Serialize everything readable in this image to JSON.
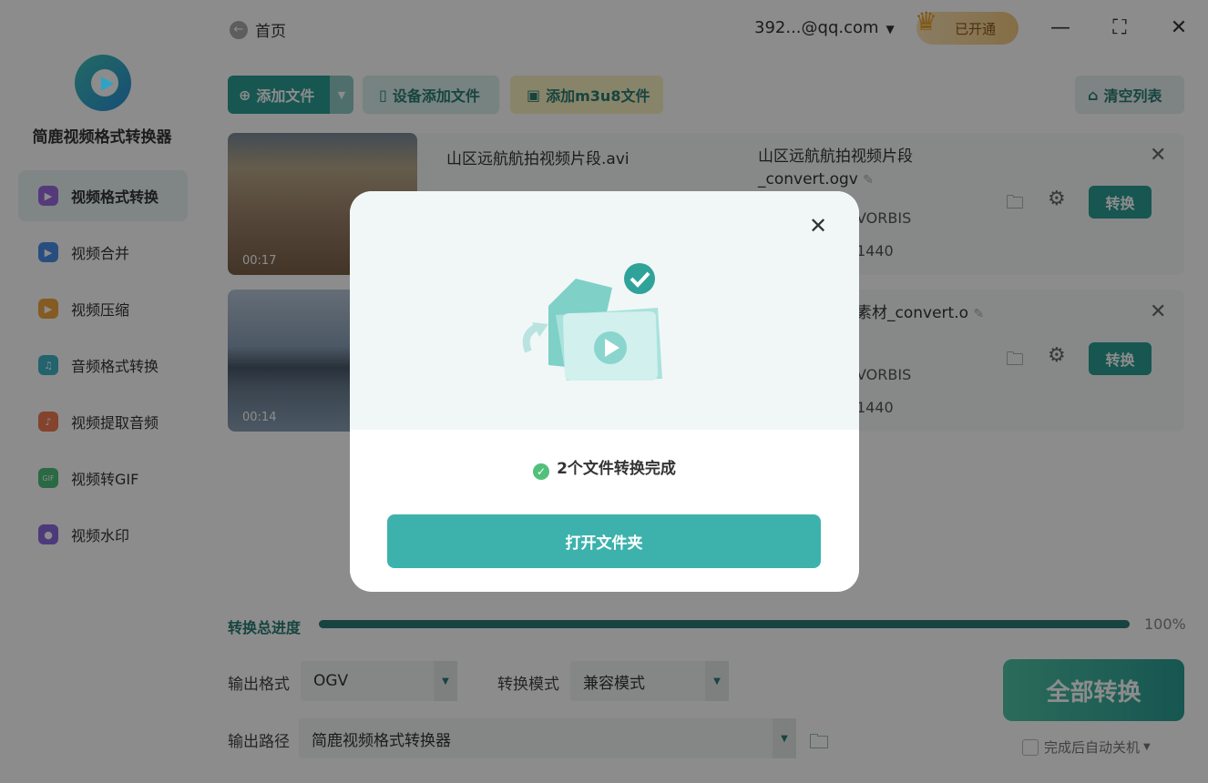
{
  "app": {
    "name": "简鹿视频格式转换器"
  },
  "sidebar": {
    "items": [
      {
        "label": "视频格式转换",
        "color": "#9b6be0",
        "icon": "video-convert-icon"
      },
      {
        "label": "视频合并",
        "color": "#4a8fe8",
        "icon": "video-merge-icon"
      },
      {
        "label": "视频压缩",
        "color": "#f0a640",
        "icon": "video-compress-icon"
      },
      {
        "label": "音频格式转换",
        "color": "#3fb4c6",
        "icon": "audio-convert-icon"
      },
      {
        "label": "视频提取音频",
        "color": "#f07a50",
        "icon": "extract-audio-icon"
      },
      {
        "label": "视频转GIF",
        "color": "#4cc07a",
        "icon": "gif-icon"
      },
      {
        "label": "视频水印",
        "color": "#8a6be0",
        "icon": "watermark-icon"
      }
    ]
  },
  "header": {
    "back_label": "首页",
    "user": "392...@qq.com",
    "vip_label": "已开通"
  },
  "toolbar": {
    "add_file": "添加文件",
    "device_add": "设备添加文件",
    "add_m3u8": "添加m3u8文件",
    "clear_list": "清空列表"
  },
  "files": [
    {
      "duration": "00:17",
      "name": "山区远航航拍视频片段.avi",
      "output_name": "山区远航航拍视频片段_convert.ogv",
      "codec": "VORBIS",
      "resolution": "1440",
      "convert_label": "转换"
    },
    {
      "duration": "00:14",
      "output_name": "素材_convert.o",
      "codec": "VORBIS",
      "resolution": "1440",
      "convert_label": "转换"
    }
  ],
  "bottom": {
    "progress_label": "转换总进度",
    "progress_value": 1.0,
    "progress_text": "100%",
    "format_label": "输出格式",
    "format_value": "OGV",
    "mode_label": "转换模式",
    "mode_value": "兼容模式",
    "path_label": "输出路径",
    "path_value": "简鹿视频格式转换器",
    "convert_all": "全部转换",
    "auto_shutdown": "完成后自动关机"
  },
  "modal": {
    "message": "2个文件转换完成",
    "open_folder": "打开文件夹"
  }
}
